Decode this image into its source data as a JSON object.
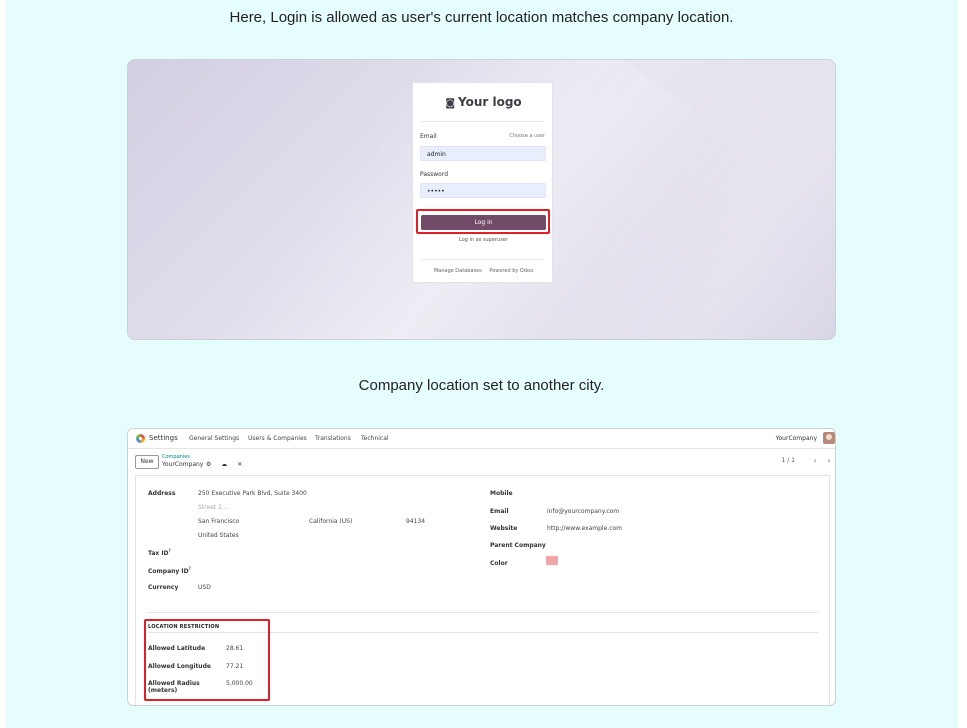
{
  "captions": {
    "first": "Here, Login is allowed as user's current location matches company location.",
    "second": "Company location set to another city."
  },
  "login": {
    "logo_text": "Your logo",
    "logo_icon": "camera-icon",
    "email_label": "Email",
    "choose_user": "Choose a user",
    "email_value": "admin",
    "password_label": "Password",
    "password_value": "•••••",
    "login_button": "Log in",
    "superuser_link": "Log in as superuser",
    "manage_databases": "Manage Databases",
    "powered_by": "Powered by Odoo",
    "highlight_color": "#e21f26",
    "button_color": "#714b67"
  },
  "settings": {
    "app_name": "Settings",
    "menu": [
      "General Settings",
      "Users & Companies",
      "Translations",
      "Technical"
    ],
    "company": "YourCompany",
    "new_button": "New",
    "breadcrumb_parent": "Companies",
    "breadcrumb_current": "YourCompany",
    "record_icons": "⚙ ☁ ✕",
    "pager": "1 / 1",
    "pager_prev": "‹",
    "pager_next": "›",
    "address_label": "Address",
    "street": "250 Executive Park Blvd, Suite 3400",
    "street2_placeholder": "Street 2...",
    "city": "San Francisco",
    "state": "California (US)",
    "zip": "94134",
    "country": "United States",
    "tax_id_label": "Tax ID",
    "company_id_label": "Company ID",
    "currency_label": "Currency",
    "currency_value": "USD",
    "mobile_label": "Mobile",
    "email_label": "Email",
    "email_value": "info@yourcompany.com",
    "website_label": "Website",
    "website_value": "http://www.example.com",
    "parent_company_label": "Parent Company",
    "color_label": "Color",
    "color_value": "#f0a7a9",
    "section_title": "LOCATION RESTRICTION",
    "latitude_label": "Allowed Latitude",
    "latitude_value": "28.61",
    "longitude_label": "Allowed Longitude",
    "longitude_value": "77.21",
    "radius_label_1": "Allowed Radius",
    "radius_label_2": "(meters)",
    "radius_value": "5,000.00"
  }
}
